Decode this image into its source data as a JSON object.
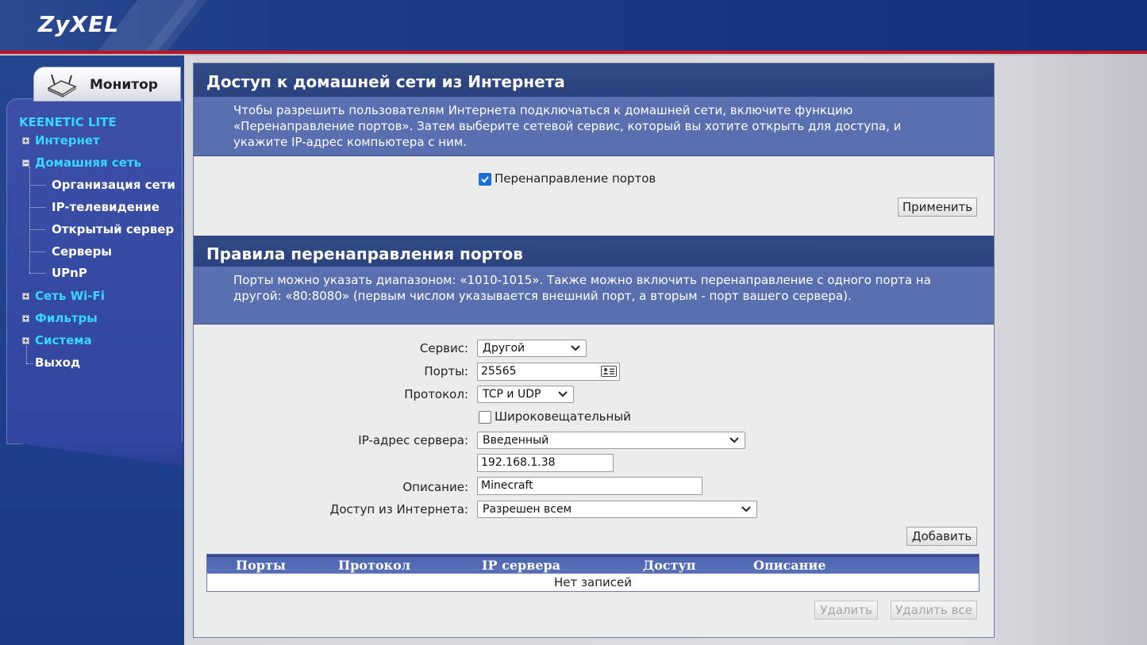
{
  "header": {
    "logo": "ZyXEL"
  },
  "sidebar": {
    "tab_label": "Монитор",
    "product": "KEENETIC LITE",
    "items": [
      {
        "label": "Интернет"
      },
      {
        "label": "Домашняя сеть"
      },
      {
        "label": "Организация сети"
      },
      {
        "label": "IP-телевидение"
      },
      {
        "label": "Открытый сервер"
      },
      {
        "label": "Серверы"
      },
      {
        "label": "UPnP"
      },
      {
        "label": "Сеть Wi-Fi"
      },
      {
        "label": "Фильтры"
      },
      {
        "label": "Система"
      },
      {
        "label": "Выход"
      }
    ]
  },
  "section1": {
    "title": "Доступ к домашней сети из Интернета",
    "desc": "Чтобы разрешить пользователям Интернета подключаться к домашней сети, включите функцию «Перенаправление портов». Затем выберите сетевой сервис, который вы хотите открыть для доступа, и укажите IP-адрес компьютера с ним.",
    "checkbox_label": "Перенаправление портов",
    "apply_label": "Применить"
  },
  "section2": {
    "title": "Правила перенаправления портов",
    "desc": "Порты можно указать диапазоном: «1010-1015». Также можно включить перенаправление с одного порта на другой: «80:8080» (первым числом указывается внешний порт, а вторым - порт вашего сервера).",
    "service_label": "Сервис:",
    "service_value": "Другой",
    "ports_label": "Порты:",
    "ports_value": "25565",
    "protocol_label": "Протокол:",
    "protocol_value": "TCP и UDP",
    "broadcast_label": "Широковещательный",
    "server_ip_label": "IP-адрес сервера:",
    "server_ip_mode": "Введенный",
    "server_ip_value": "192.168.1.38",
    "description_label": "Описание:",
    "description_value": "Minecraft",
    "access_label": "Доступ из Интернета:",
    "access_value": "Разрешен всем",
    "add_label": "Добавить",
    "table": {
      "columns": [
        "Порты",
        "Протокол",
        "IP сервера",
        "Доступ",
        "Описание"
      ],
      "empty_text": "Нет записей"
    },
    "delete_label": "Удалить",
    "delete_all_label": "Удалить все"
  }
}
